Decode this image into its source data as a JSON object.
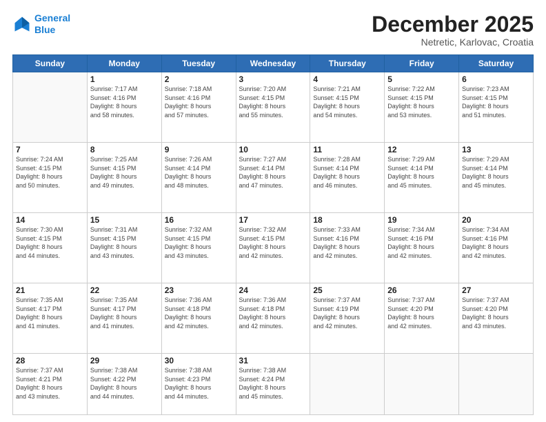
{
  "logo": {
    "line1": "General",
    "line2": "Blue"
  },
  "header": {
    "month": "December 2025",
    "location": "Netretic, Karlovac, Croatia"
  },
  "weekdays": [
    "Sunday",
    "Monday",
    "Tuesday",
    "Wednesday",
    "Thursday",
    "Friday",
    "Saturday"
  ],
  "weeks": [
    [
      {
        "day": "",
        "sunrise": "",
        "sunset": "",
        "daylight": ""
      },
      {
        "day": "1",
        "sunrise": "Sunrise: 7:17 AM",
        "sunset": "Sunset: 4:16 PM",
        "daylight": "Daylight: 8 hours and 58 minutes."
      },
      {
        "day": "2",
        "sunrise": "Sunrise: 7:18 AM",
        "sunset": "Sunset: 4:16 PM",
        "daylight": "Daylight: 8 hours and 57 minutes."
      },
      {
        "day": "3",
        "sunrise": "Sunrise: 7:20 AM",
        "sunset": "Sunset: 4:15 PM",
        "daylight": "Daylight: 8 hours and 55 minutes."
      },
      {
        "day": "4",
        "sunrise": "Sunrise: 7:21 AM",
        "sunset": "Sunset: 4:15 PM",
        "daylight": "Daylight: 8 hours and 54 minutes."
      },
      {
        "day": "5",
        "sunrise": "Sunrise: 7:22 AM",
        "sunset": "Sunset: 4:15 PM",
        "daylight": "Daylight: 8 hours and 53 minutes."
      },
      {
        "day": "6",
        "sunrise": "Sunrise: 7:23 AM",
        "sunset": "Sunset: 4:15 PM",
        "daylight": "Daylight: 8 hours and 51 minutes."
      }
    ],
    [
      {
        "day": "7",
        "sunrise": "Sunrise: 7:24 AM",
        "sunset": "Sunset: 4:15 PM",
        "daylight": "Daylight: 8 hours and 50 minutes."
      },
      {
        "day": "8",
        "sunrise": "Sunrise: 7:25 AM",
        "sunset": "Sunset: 4:15 PM",
        "daylight": "Daylight: 8 hours and 49 minutes."
      },
      {
        "day": "9",
        "sunrise": "Sunrise: 7:26 AM",
        "sunset": "Sunset: 4:14 PM",
        "daylight": "Daylight: 8 hours and 48 minutes."
      },
      {
        "day": "10",
        "sunrise": "Sunrise: 7:27 AM",
        "sunset": "Sunset: 4:14 PM",
        "daylight": "Daylight: 8 hours and 47 minutes."
      },
      {
        "day": "11",
        "sunrise": "Sunrise: 7:28 AM",
        "sunset": "Sunset: 4:14 PM",
        "daylight": "Daylight: 8 hours and 46 minutes."
      },
      {
        "day": "12",
        "sunrise": "Sunrise: 7:29 AM",
        "sunset": "Sunset: 4:14 PM",
        "daylight": "Daylight: 8 hours and 45 minutes."
      },
      {
        "day": "13",
        "sunrise": "Sunrise: 7:29 AM",
        "sunset": "Sunset: 4:14 PM",
        "daylight": "Daylight: 8 hours and 45 minutes."
      }
    ],
    [
      {
        "day": "14",
        "sunrise": "Sunrise: 7:30 AM",
        "sunset": "Sunset: 4:15 PM",
        "daylight": "Daylight: 8 hours and 44 minutes."
      },
      {
        "day": "15",
        "sunrise": "Sunrise: 7:31 AM",
        "sunset": "Sunset: 4:15 PM",
        "daylight": "Daylight: 8 hours and 43 minutes."
      },
      {
        "day": "16",
        "sunrise": "Sunrise: 7:32 AM",
        "sunset": "Sunset: 4:15 PM",
        "daylight": "Daylight: 8 hours and 43 minutes."
      },
      {
        "day": "17",
        "sunrise": "Sunrise: 7:32 AM",
        "sunset": "Sunset: 4:15 PM",
        "daylight": "Daylight: 8 hours and 42 minutes."
      },
      {
        "day": "18",
        "sunrise": "Sunrise: 7:33 AM",
        "sunset": "Sunset: 4:16 PM",
        "daylight": "Daylight: 8 hours and 42 minutes."
      },
      {
        "day": "19",
        "sunrise": "Sunrise: 7:34 AM",
        "sunset": "Sunset: 4:16 PM",
        "daylight": "Daylight: 8 hours and 42 minutes."
      },
      {
        "day": "20",
        "sunrise": "Sunrise: 7:34 AM",
        "sunset": "Sunset: 4:16 PM",
        "daylight": "Daylight: 8 hours and 42 minutes."
      }
    ],
    [
      {
        "day": "21",
        "sunrise": "Sunrise: 7:35 AM",
        "sunset": "Sunset: 4:17 PM",
        "daylight": "Daylight: 8 hours and 41 minutes."
      },
      {
        "day": "22",
        "sunrise": "Sunrise: 7:35 AM",
        "sunset": "Sunset: 4:17 PM",
        "daylight": "Daylight: 8 hours and 41 minutes."
      },
      {
        "day": "23",
        "sunrise": "Sunrise: 7:36 AM",
        "sunset": "Sunset: 4:18 PM",
        "daylight": "Daylight: 8 hours and 42 minutes."
      },
      {
        "day": "24",
        "sunrise": "Sunrise: 7:36 AM",
        "sunset": "Sunset: 4:18 PM",
        "daylight": "Daylight: 8 hours and 42 minutes."
      },
      {
        "day": "25",
        "sunrise": "Sunrise: 7:37 AM",
        "sunset": "Sunset: 4:19 PM",
        "daylight": "Daylight: 8 hours and 42 minutes."
      },
      {
        "day": "26",
        "sunrise": "Sunrise: 7:37 AM",
        "sunset": "Sunset: 4:20 PM",
        "daylight": "Daylight: 8 hours and 42 minutes."
      },
      {
        "day": "27",
        "sunrise": "Sunrise: 7:37 AM",
        "sunset": "Sunset: 4:20 PM",
        "daylight": "Daylight: 8 hours and 43 minutes."
      }
    ],
    [
      {
        "day": "28",
        "sunrise": "Sunrise: 7:37 AM",
        "sunset": "Sunset: 4:21 PM",
        "daylight": "Daylight: 8 hours and 43 minutes."
      },
      {
        "day": "29",
        "sunrise": "Sunrise: 7:38 AM",
        "sunset": "Sunset: 4:22 PM",
        "daylight": "Daylight: 8 hours and 44 minutes."
      },
      {
        "day": "30",
        "sunrise": "Sunrise: 7:38 AM",
        "sunset": "Sunset: 4:23 PM",
        "daylight": "Daylight: 8 hours and 44 minutes."
      },
      {
        "day": "31",
        "sunrise": "Sunrise: 7:38 AM",
        "sunset": "Sunset: 4:24 PM",
        "daylight": "Daylight: 8 hours and 45 minutes."
      },
      {
        "day": "",
        "sunrise": "",
        "sunset": "",
        "daylight": ""
      },
      {
        "day": "",
        "sunrise": "",
        "sunset": "",
        "daylight": ""
      },
      {
        "day": "",
        "sunrise": "",
        "sunset": "",
        "daylight": ""
      }
    ]
  ]
}
